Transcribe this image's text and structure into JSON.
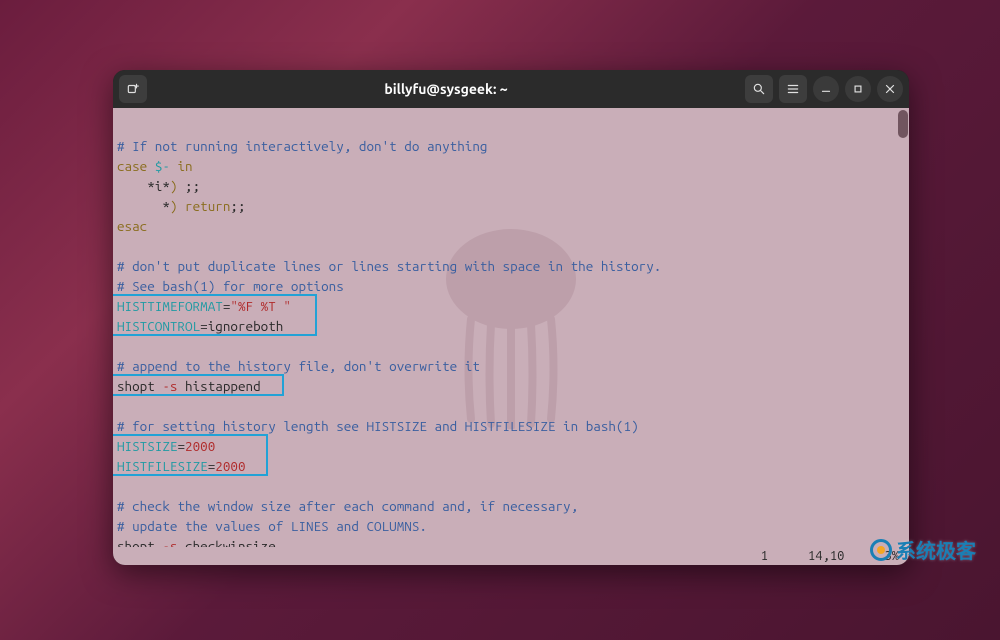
{
  "window": {
    "title": "billyfu@sysgeek: ~"
  },
  "code": {
    "l1_comment": "# If not running interactively, don't do anything",
    "l2_case": "case",
    "l2_dash": "$-",
    "l2_in": " in",
    "l3": "    *i*",
    "l3_paren": ")",
    "l3_semis": " ;;",
    "l4_star": "      *",
    "l4_paren": ")",
    "l4_ret": " return",
    "l4_semis": ";;",
    "l5_esac": "esac",
    "l7_comment": "# don't put duplicate lines or lines starting with space in the history.",
    "l8_comment": "# See bash(1) for more options",
    "l9_var": "HISTTIMEFORMAT",
    "l9_eq": "=",
    "l9_val": "\"%F %T \"",
    "l10_var": "HISTCONTROL",
    "l10_eq": "=",
    "l10_val": "ignoreboth",
    "l12_comment": "# append to the history file, don't overwrite it",
    "l13_shopt": "shopt ",
    "l13_opt": "-s",
    "l13_arg": " histappend",
    "l15_comment": "# for setting history length see HISTSIZE and HISTFILESIZE in bash(1)",
    "l16_var": "HISTSIZE",
    "l16_eq": "=",
    "l16_val": "2000",
    "l17_var": "HISTFILESIZE",
    "l17_eq": "=",
    "l17_val": "2000",
    "l19_comment": "# check the window size after each command and, if necessary,",
    "l20_comment": "# update the values of LINES and COLUMNS.",
    "l21_shopt": "shopt ",
    "l21_opt": "-s",
    "l21_arg": " checkwinsize"
  },
  "status": {
    "count": "1",
    "pos": "14,10",
    "pct": "3%"
  },
  "watermark": "系统极客"
}
